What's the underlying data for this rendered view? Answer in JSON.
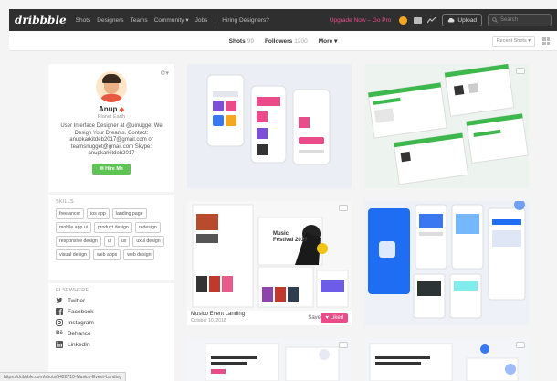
{
  "nav": {
    "logo": "dribbble",
    "links": [
      "Shots",
      "Designers",
      "Teams",
      "Community ▾",
      "Jobs"
    ],
    "separator": "|",
    "hiring": "Hiring Designers?",
    "upgrade": "Upgrade Now – Go Pro",
    "upload": "Upload",
    "search_placeholder": "Search"
  },
  "subnav": {
    "tabs": [
      {
        "label": "Shots",
        "count": "99"
      },
      {
        "label": "Followers",
        "count": "1200"
      },
      {
        "label": "More ▾",
        "count": ""
      }
    ],
    "sort": "Recent Shots ▾"
  },
  "profile": {
    "name": "Anup",
    "location": "Planet Earth",
    "bio": "User Interface Designer at @uinugget We Design Your Dreams. Contact: anupkarkitdeb2017@gmail.com or teamsnugget@gmail.com Skype: anupkarkitdeb2017",
    "hire_label": "Hire Me"
  },
  "skills": {
    "label": "SKILLS",
    "tags": [
      "freelancer",
      "ios app",
      "landing page",
      "mobile app ui",
      "product design",
      "redesign",
      "responsive design",
      "ui",
      "ux",
      "uxui design",
      "visual design",
      "web apps",
      "web design"
    ]
  },
  "elsewhere": {
    "label": "ELSEWHERE",
    "items": [
      {
        "icon": "twitter-icon",
        "label": "Twitter"
      },
      {
        "icon": "facebook-icon",
        "label": "Facebook"
      },
      {
        "icon": "instagram-icon",
        "label": "Instagram"
      },
      {
        "icon": "behance-icon",
        "label": "Behance"
      },
      {
        "icon": "linkedin-icon",
        "label": "LinkedIn"
      }
    ]
  },
  "shots": {
    "featured_title": "Musico Event Landing",
    "featured_date": "October 10, 2018",
    "save_label": "Save",
    "liked_label": "♥ Liked",
    "hero_text_1": "Music",
    "hero_text_2": "Festival 2019"
  },
  "status_url": "https://dribbble.com/shots/5428710-Musico-Event-Landing",
  "colors": {
    "brand_pink": "#ea4c89",
    "hire_green": "#5ec454",
    "nav_bg": "#2f2f2f"
  }
}
